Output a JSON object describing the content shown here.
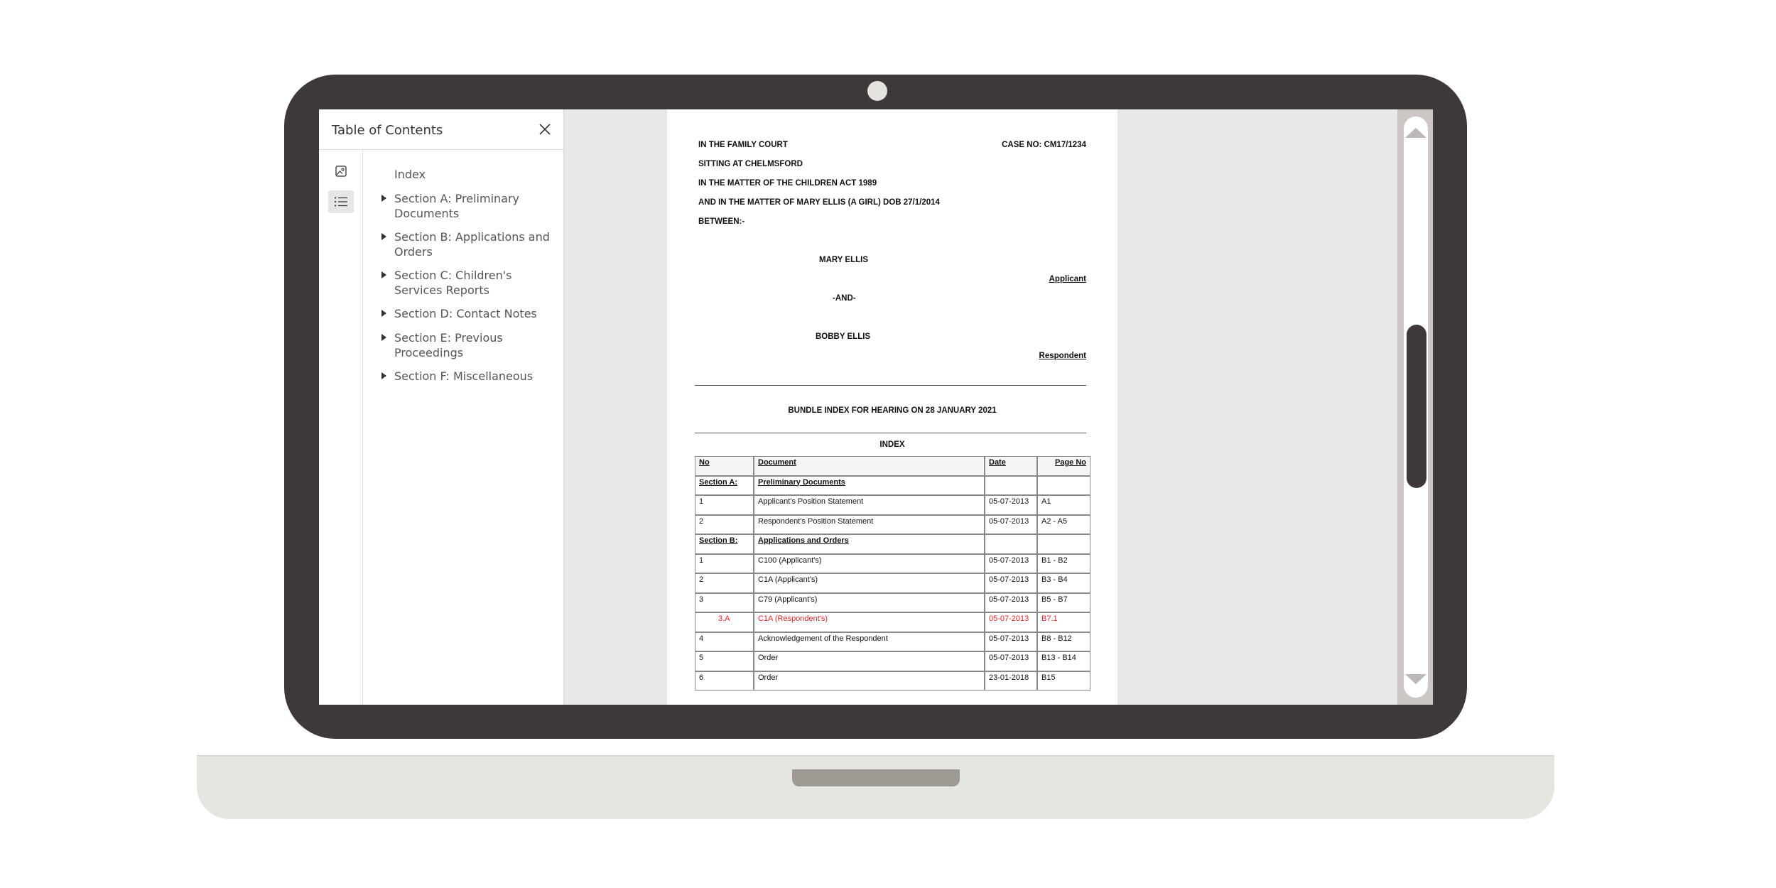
{
  "toc": {
    "title": "Table of Contents",
    "items": [
      {
        "label": "Index",
        "expandable": false
      },
      {
        "label": "Section A: Preliminary Documents",
        "expandable": true
      },
      {
        "label": "Section B: Applications and Orders",
        "expandable": true
      },
      {
        "label": "Section C: Children's Services Reports",
        "expandable": true
      },
      {
        "label": "Section D: Contact Notes",
        "expandable": true
      },
      {
        "label": "Section E: Previous Proceedings",
        "expandable": true
      },
      {
        "label": "Section F: Miscellaneous",
        "expandable": true
      }
    ]
  },
  "icons": {
    "close": "close-icon",
    "thumbnails": "image-icon",
    "outline": "list-icon"
  },
  "document": {
    "court": "IN THE FAMILY COURT",
    "case_no": "CASE NO: CM17/1234",
    "sitting": "SITTING AT CHELMSFORD",
    "matter_act": "IN THE MATTER OF THE CHILDREN ACT 1989",
    "matter_child": "AND IN THE MATTER OF MARY ELLIS (A GIRL) DOB 27/1/2014",
    "between": "BETWEEN:-",
    "applicant_name": "MARY ELLIS",
    "applicant_role": "Applicant",
    "and": "-AND-",
    "respondent_name": "BOBBY ELLIS",
    "respondent_role": "Respondent",
    "bundle_title": "BUNDLE INDEX FOR HEARING ON 28 JANUARY 2021",
    "index_heading": "INDEX",
    "table": {
      "headers": [
        "No",
        "Document",
        "Date",
        "Page No"
      ],
      "rows": [
        {
          "type": "section",
          "no": "Section A:",
          "doc": "Preliminary Documents",
          "date": "",
          "page": ""
        },
        {
          "type": "row",
          "no": "1",
          "doc": "Applicant's Position Statement",
          "date": "05-07-2013",
          "page": "A1"
        },
        {
          "type": "row",
          "no": "2",
          "doc": "Respondent's Position Statement",
          "date": "05-07-2013",
          "page": "A2 - A5"
        },
        {
          "type": "section",
          "no": "Section B:",
          "doc": "Applications and Orders",
          "date": "",
          "page": ""
        },
        {
          "type": "row",
          "no": "1",
          "doc": "C100 (Applicant's)",
          "date": "05-07-2013",
          "page": "B1 - B2"
        },
        {
          "type": "row",
          "no": "2",
          "doc": "C1A (Applicant's)",
          "date": "05-07-2013",
          "page": "B3 - B4"
        },
        {
          "type": "row",
          "no": "3",
          "doc": "C79 (Applicant's)",
          "date": "05-07-2013",
          "page": "B5 - B7"
        },
        {
          "type": "highlight",
          "no": "3.A",
          "doc": "C1A (Respondent's)",
          "date": "05-07-2013",
          "page": "B7.1"
        },
        {
          "type": "row",
          "no": "4",
          "doc": "Acknowledgement of the Respondent",
          "date": "05-07-2013",
          "page": "B8 - B12"
        },
        {
          "type": "row",
          "no": "5",
          "doc": "Order",
          "date": "05-07-2013",
          "page": "B13 - B14"
        },
        {
          "type": "row",
          "no": "6",
          "doc": "Order",
          "date": "23-01-2018",
          "page": "B15"
        }
      ]
    }
  },
  "colors": {
    "frame": "#3f3839",
    "highlight_text": "#e82525",
    "screen_bg": "#e8e8e8"
  }
}
